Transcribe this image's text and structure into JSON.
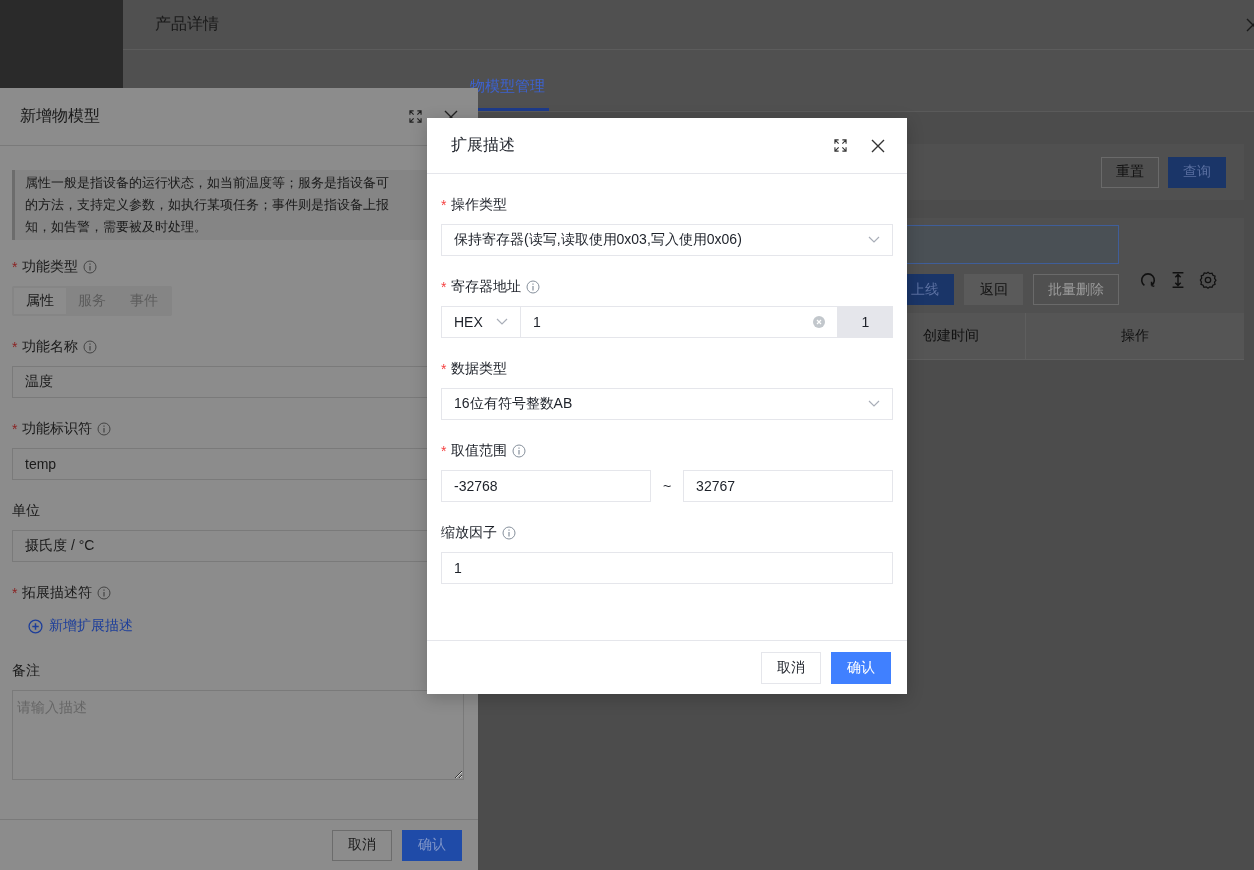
{
  "page": {
    "title": "产品详情",
    "tabs": [
      {
        "label": "物模型管理",
        "selected": true
      }
    ],
    "toolbar_buttons": [
      {
        "label": "重置",
        "kind": "default"
      },
      {
        "label": "查询",
        "kind": "primary"
      }
    ],
    "action_buttons": [
      {
        "label": "上线",
        "kind": "primary",
        "disabled": false
      },
      {
        "label": "返回",
        "kind": "secondary",
        "disabled": false
      },
      {
        "label": "批量删除",
        "kind": "default",
        "disabled": true
      }
    ],
    "table": {
      "columns": [
        "创建时间",
        "操作"
      ]
    }
  },
  "drawer": {
    "title": "新增物模型",
    "description_lines": [
      "属性一般是指设备的运行状态，如当前温度等；服务是指设备可",
      "的方法，支持定义参数，如执行某项任务；事件则是指设备上报",
      "知，如告警，需要被及时处理。"
    ],
    "fields": [
      {
        "kind": "segmented",
        "label": "功能类型",
        "required_mark": "*",
        "info": true,
        "options": [
          {
            "label": "属性",
            "selected": true
          },
          {
            "label": "服务",
            "selected": false
          },
          {
            "label": "事件",
            "selected": false
          }
        ]
      },
      {
        "kind": "input",
        "label": "功能名称",
        "required_mark": "*",
        "info": true,
        "value": "温度"
      },
      {
        "kind": "input",
        "label": "功能标识符",
        "required_mark": "*",
        "info": true,
        "value": "temp"
      },
      {
        "kind": "input",
        "label": "单位",
        "value": "摄氏度 / °C"
      },
      {
        "kind": "link",
        "label": "拓展描述符",
        "required_mark": "*",
        "info": true,
        "text": "新增扩展描述"
      },
      {
        "kind": "textarea",
        "label": "备注",
        "placeholder": "请输入描述"
      }
    ],
    "buttons": [
      {
        "label": "取消",
        "kind": "default"
      },
      {
        "label": "确认",
        "kind": "primary"
      }
    ]
  },
  "modal": {
    "title": "扩展描述",
    "fields": [
      {
        "kind": "select",
        "label": "操作类型",
        "required_mark": "*",
        "value": "保持寄存器(读写,读取使用0x03,写入使用0x06)"
      },
      {
        "kind": "address",
        "label": "寄存器地址",
        "required_mark": "*",
        "info": true,
        "mode": "HEX",
        "value": "1",
        "addon": "1"
      },
      {
        "kind": "select",
        "label": "数据类型",
        "required_mark": "*",
        "value": "16位有符号整数AB"
      },
      {
        "kind": "range",
        "label": "取值范围",
        "required_mark": "*",
        "info": true,
        "min": "-32768",
        "separator": "~",
        "max": "32767"
      },
      {
        "kind": "input",
        "label": "缩放因子",
        "info": true,
        "value": "1"
      }
    ],
    "buttons": [
      {
        "label": "取消",
        "kind": "default"
      },
      {
        "label": "确认",
        "kind": "primary"
      }
    ]
  }
}
